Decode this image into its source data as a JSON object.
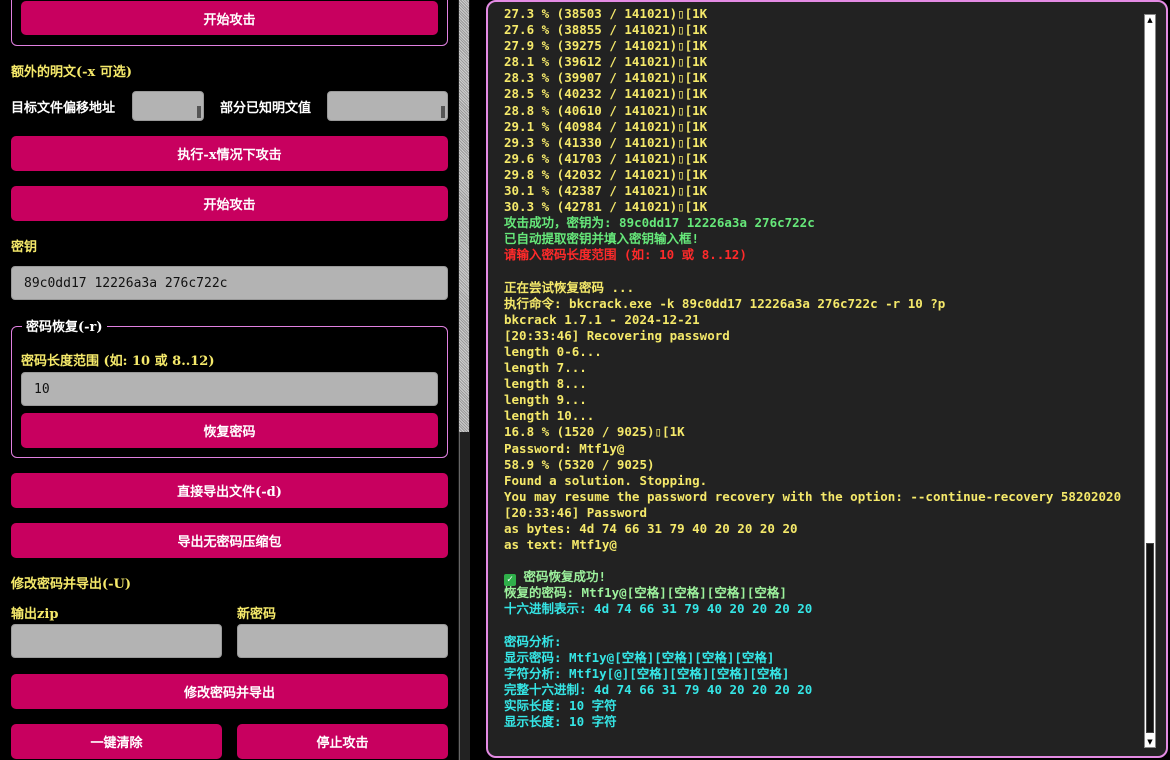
{
  "left": {
    "start_attack_top": "开始攻击",
    "extra_plaintext_label": "额外的明文(-x 可选)",
    "offset_label": "目标文件偏移地址",
    "offset_value": "",
    "partial_plain_label": "部分已知明文值",
    "partial_plain_value": "",
    "exec_x_button": "执行-x情况下攻击",
    "start_attack_button": "开始攻击",
    "key_label": "密钥",
    "key_value": "89c0dd17 12226a3a 276c722c",
    "recover": {
      "legend": "密码恢复(-r)",
      "range_label": "密码长度范围 (如: 10 或 8..12)",
      "range_value": "10",
      "recover_button": "恢复密码"
    },
    "export_file_button": "直接导出文件(-d)",
    "export_nopass_button": "导出无密码压缩包",
    "modify_label": "修改密码并导出(-U)",
    "output_zip_label": "输出zip",
    "output_zip_value": "",
    "new_password_label": "新密码",
    "new_password_value": "",
    "modify_export_button": "修改密码并导出",
    "clear_button": "一键清除",
    "stop_button": "停止攻击"
  },
  "terminal": {
    "lines": [
      {
        "text": "27.3 % (38503 / 141021)\u0000[1K",
        "color": "yellow"
      },
      {
        "text": "27.6 % (38855 / 141021)\u0000[1K",
        "color": "yellow"
      },
      {
        "text": "27.9 % (39275 / 141021)\u0000[1K",
        "color": "yellow"
      },
      {
        "text": "28.1 % (39612 / 141021)\u0000[1K",
        "color": "yellow"
      },
      {
        "text": "28.3 % (39907 / 141021)\u0000[1K",
        "color": "yellow"
      },
      {
        "text": "28.5 % (40232 / 141021)\u0000[1K",
        "color": "yellow"
      },
      {
        "text": "28.8 % (40610 / 141021)\u0000[1K",
        "color": "yellow"
      },
      {
        "text": "29.1 % (40984 / 141021)\u0000[1K",
        "color": "yellow"
      },
      {
        "text": "29.3 % (41330 / 141021)\u0000[1K",
        "color": "yellow"
      },
      {
        "text": "29.6 % (41703 / 141021)\u0000[1K",
        "color": "yellow"
      },
      {
        "text": "29.8 % (42032 / 141021)\u0000[1K",
        "color": "yellow"
      },
      {
        "text": "30.1 % (42387 / 141021)\u0000[1K",
        "color": "yellow"
      },
      {
        "text": "30.3 % (42781 / 141021)\u0000[1K",
        "color": "yellow"
      },
      {
        "text": "攻击成功，密钥为: 89c0dd17 12226a3a 276c722c",
        "color": "green"
      },
      {
        "text": "已自动提取密钥并填入密钥输入框!",
        "color": "green"
      },
      {
        "text": "请输入密码长度范围 (如: 10 或 8..12)",
        "color": "red"
      },
      {
        "text": "",
        "color": "yellow"
      },
      {
        "text": "正在尝试恢复密码 ...",
        "color": "yellow"
      },
      {
        "text": "执行命令: bkcrack.exe -k 89c0dd17 12226a3a 276c722c -r 10 ?p",
        "color": "yellow"
      },
      {
        "text": "bkcrack 1.7.1 - 2024-12-21",
        "color": "yellow"
      },
      {
        "text": "[20:33:46] Recovering password",
        "color": "yellow"
      },
      {
        "text": "length 0-6...",
        "color": "yellow"
      },
      {
        "text": "length 7...",
        "color": "yellow"
      },
      {
        "text": "length 8...",
        "color": "yellow"
      },
      {
        "text": "length 9...",
        "color": "yellow"
      },
      {
        "text": "length 10...",
        "color": "yellow"
      },
      {
        "text": "16.8 % (1520 / 9025)\u0000[1K",
        "color": "yellow"
      },
      {
        "text": "Password: Mtf1y@",
        "color": "yellow"
      },
      {
        "text": "58.9 % (5320 / 9025)",
        "color": "yellow"
      },
      {
        "text": "Found a solution. Stopping.",
        "color": "yellow"
      },
      {
        "text": "You may resume the password recovery with the option: --continue-recovery 58202020",
        "color": "yellow"
      },
      {
        "text": "[20:33:46] Password",
        "color": "yellow"
      },
      {
        "text": "as bytes: 4d 74 66 31 79 40 20 20 20 20",
        "color": "yellow"
      },
      {
        "text": "as text: Mtf1y@",
        "color": "yellow"
      },
      {
        "text": "",
        "color": "yellow"
      },
      {
        "text": " 密码恢复成功!",
        "color": "lgreen",
        "check": true
      },
      {
        "text": "恢复的密码: Mtf1y@[空格][空格][空格][空格]",
        "color": "lgreen"
      },
      {
        "text": "十六进制表示: 4d 74 66 31 79 40 20 20 20 20",
        "color": "cyan"
      },
      {
        "text": "",
        "color": "cyan"
      },
      {
        "text": "密码分析:",
        "color": "cyan"
      },
      {
        "text": "显示密码: Mtf1y@[空格][空格][空格][空格]",
        "color": "cyan"
      },
      {
        "text": "字符分析: Mtf1y[@][空格][空格][空格][空格]",
        "color": "cyan"
      },
      {
        "text": "完整十六进制: 4d 74 66 31 79 40 20 20 20 20",
        "color": "cyan"
      },
      {
        "text": "实际长度: 10 字符",
        "color": "cyan"
      },
      {
        "text": "显示长度: 10 字符",
        "color": "cyan"
      }
    ]
  },
  "colors": {
    "button": "#c8005f",
    "border": "#e48be4",
    "yellow": "#f5e96a",
    "green": "#66e87a",
    "red": "#ff2a2a",
    "cyan": "#35e6e6"
  }
}
